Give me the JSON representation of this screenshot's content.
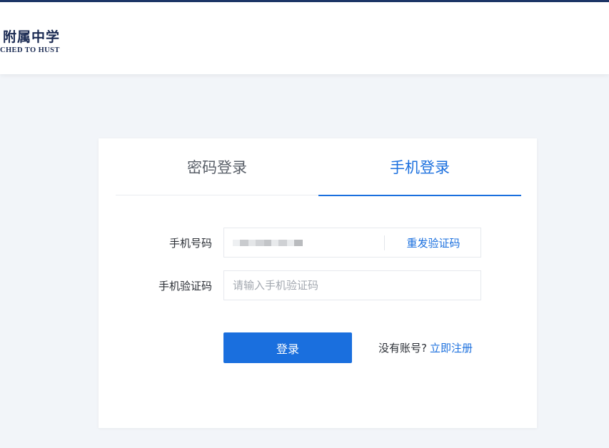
{
  "header": {
    "logo_cn": "附属中学",
    "logo_en": "CHED TO HUST"
  },
  "tabs": [
    {
      "label": "密码登录",
      "active": false
    },
    {
      "label": "手机登录",
      "active": true
    }
  ],
  "form": {
    "phone_label": "手机号码",
    "resend_label": "重发验证码",
    "code_label": "手机验证码",
    "code_placeholder": "请输入手机验证码",
    "code_value": ""
  },
  "actions": {
    "login_label": "登录",
    "no_account_text": "没有账号?",
    "register_label": "立即注册"
  },
  "colors": {
    "accent": "#1a6fde",
    "top_bar": "#1c3566",
    "page_background": "#f2f5f9"
  }
}
